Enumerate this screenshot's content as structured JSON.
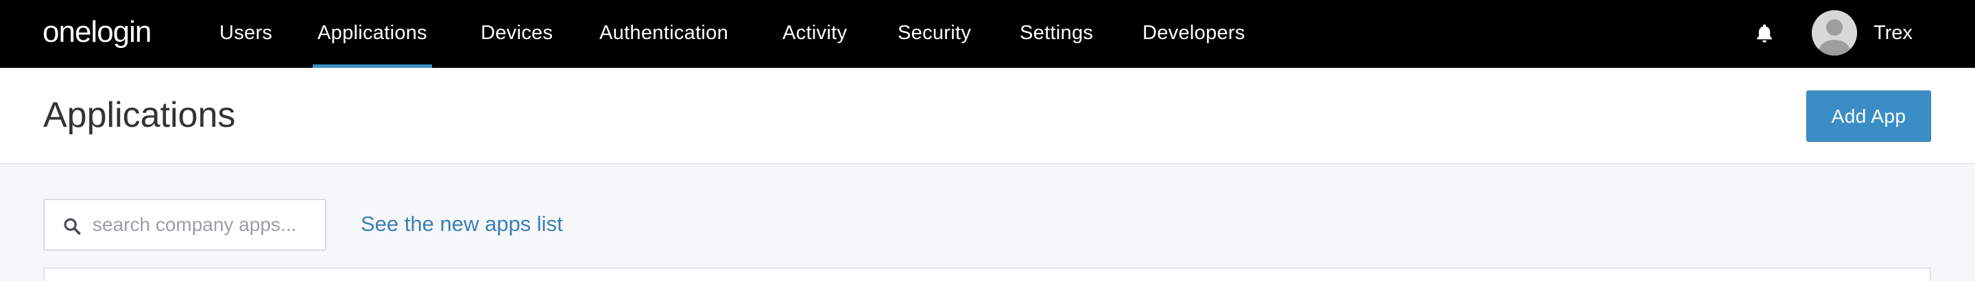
{
  "brand": {
    "logo_text": "onelogin"
  },
  "nav": {
    "items": [
      {
        "label": "Users",
        "active": false
      },
      {
        "label": "Applications",
        "active": true
      },
      {
        "label": "Devices",
        "active": false
      },
      {
        "label": "Authentication",
        "active": false
      },
      {
        "label": "Activity",
        "active": false
      },
      {
        "label": "Security",
        "active": false
      },
      {
        "label": "Settings",
        "active": false
      },
      {
        "label": "Developers",
        "active": false
      }
    ],
    "notifications_icon": "bell-icon",
    "user": {
      "name": "Trex",
      "avatar_icon": "user-avatar-icon"
    }
  },
  "header": {
    "title": "Applications",
    "add_button_label": "Add App"
  },
  "toolbar": {
    "search_placeholder": "search company apps...",
    "search_value": "",
    "new_list_link": "See the new apps list"
  },
  "colors": {
    "nav_background": "#000000",
    "active_tab_underline": "#3a8ec8",
    "primary_button": "#3b8ec5",
    "link": "#3a7fb6",
    "page_background": "#f5f7f8"
  }
}
